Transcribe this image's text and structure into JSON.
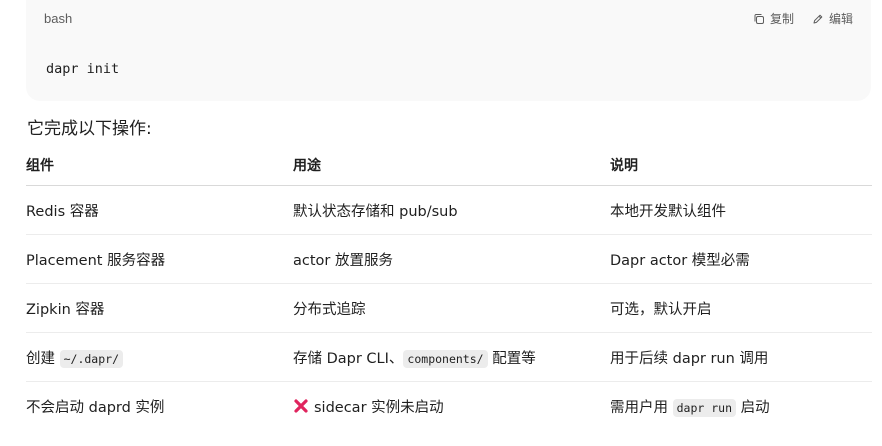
{
  "code_block": {
    "language": "bash",
    "copy_label": "复制",
    "edit_label": "编辑",
    "code": "dapr init"
  },
  "heading": "它完成以下操作:",
  "table": {
    "headers": [
      "组件",
      "用途",
      "说明"
    ],
    "rows": [
      {
        "c1": {
          "text": "Redis 容器"
        },
        "c2": {
          "text": "默认状态存储和 pub/sub"
        },
        "c3": {
          "text": "本地开发默认组件"
        }
      },
      {
        "c1": {
          "text": "Placement 服务容器"
        },
        "c2": {
          "text": "actor 放置服务"
        },
        "c3": {
          "text": "Dapr actor 模型必需"
        }
      },
      {
        "c1": {
          "text": "Zipkin 容器"
        },
        "c2": {
          "text": "分布式追踪"
        },
        "c3": {
          "text": "可选，默认开启"
        }
      },
      {
        "c1": {
          "before": "创建 ",
          "code": "~/.dapr/"
        },
        "c2": {
          "before": "存储 Dapr CLI、",
          "code": "components/",
          "after": " 配置等"
        },
        "c3": {
          "text": "用于后续 dapr run 调用"
        }
      },
      {
        "c1": {
          "text": "不会启动 daprd 实例"
        },
        "c2": {
          "icon": "red-cross-icon",
          "text": "sidecar 实例未启动"
        },
        "c3": {
          "before": "需用户用 ",
          "code": "dapr run",
          "after": " 启动"
        }
      }
    ]
  },
  "colors": {
    "code_bg": "#f9f9f9",
    "text": "#1f1f1f",
    "muted": "#5d5d5d",
    "cross": "#e0245e"
  }
}
